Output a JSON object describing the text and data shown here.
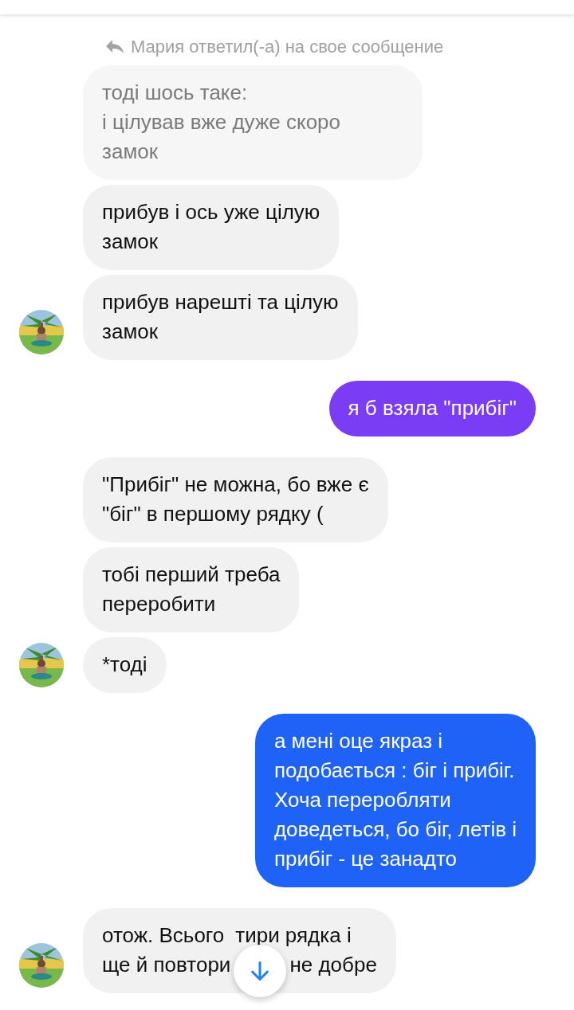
{
  "reply_notice": {
    "text": "Мария ответил(-а) на свое сообщение"
  },
  "groups": [
    {
      "kind": "received",
      "messages": [
        {
          "kind": "quote",
          "text": "тоді шось таке:\nі цілував вже дуже скоро\nзамок"
        },
        {
          "kind": "text",
          "text": "прибув і ось уже цілую\nзамок"
        },
        {
          "kind": "text",
          "text": "прибув нарешті та цілую\nзамок"
        }
      ]
    },
    {
      "kind": "sent",
      "messages": [
        {
          "kind": "text",
          "text": "я б взяла \"прибіг\"",
          "color": "#7a3cf4"
        }
      ]
    },
    {
      "kind": "received",
      "messages": [
        {
          "kind": "text",
          "text": "\"Прибіг\" не можна, бо вже є\n\"біг\" в першому рядку ("
        },
        {
          "kind": "text",
          "text": "тобі перший треба\nпереробити"
        },
        {
          "kind": "text",
          "text": "*тоді"
        }
      ]
    },
    {
      "kind": "sent",
      "messages": [
        {
          "kind": "text",
          "text": "а мені оце якраз і\nподобається : біг і прибіг.\nХоча переробляти\nдоведеться, бо біг, летів і\nприбіг - це занадто",
          "color": "#1f62f6"
        }
      ]
    },
    {
      "kind": "received",
      "messages": [
        {
          "kind": "covered",
          "lines": [
            [
              "отож. Всього",
              "тири рядка і"
            ],
            [
              "ще й повтори",
              "не добре"
            ]
          ]
        }
      ]
    }
  ],
  "scroll_button": {
    "kind": "down"
  }
}
